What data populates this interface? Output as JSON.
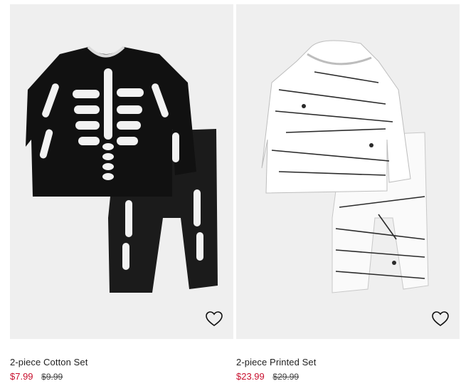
{
  "products": [
    {
      "name": "2-piece Cotton Set",
      "price_sale": "$7.99",
      "price_original": "$9.99",
      "image_icon": "skeleton-print-outfit",
      "favorite_icon": "heart-outline-icon"
    },
    {
      "name": "2-piece Printed Set",
      "price_sale": "$23.99",
      "price_original": "$29.99",
      "image_icon": "mummy-print-outfit",
      "favorite_icon": "heart-outline-icon"
    }
  ],
  "colors": {
    "sale_price": "#c8102e",
    "image_background": "#efefef",
    "text": "#222222"
  }
}
